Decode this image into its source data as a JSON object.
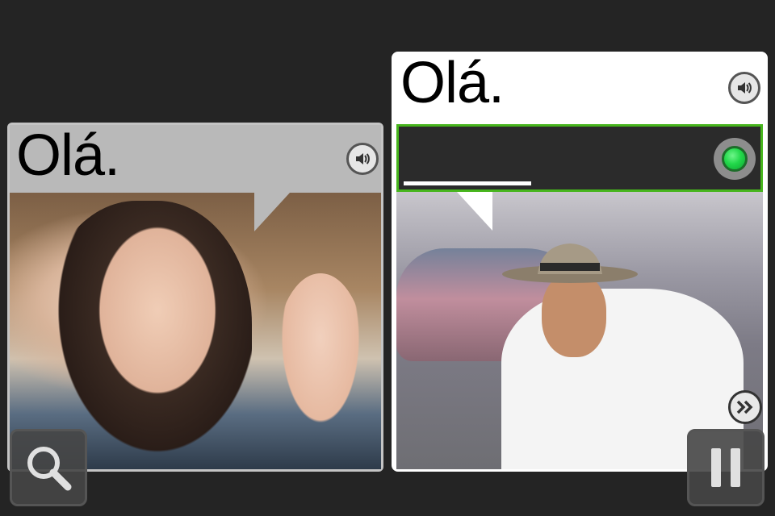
{
  "left_card": {
    "phrase": "Olá."
  },
  "right_card": {
    "phrase": "Olá.",
    "answer_text": ""
  },
  "icons": {
    "left_speaker": "speaker-icon",
    "right_speaker": "speaker-icon",
    "mic": "microphone-record-icon",
    "skip": "fast-forward-icon",
    "search": "magnifier-icon",
    "pause": "pause-icon"
  },
  "colors": {
    "background": "#242424",
    "left_caption": "#b9b9b9",
    "answer_border": "#47b51d",
    "mic_led": "#22d84a"
  }
}
